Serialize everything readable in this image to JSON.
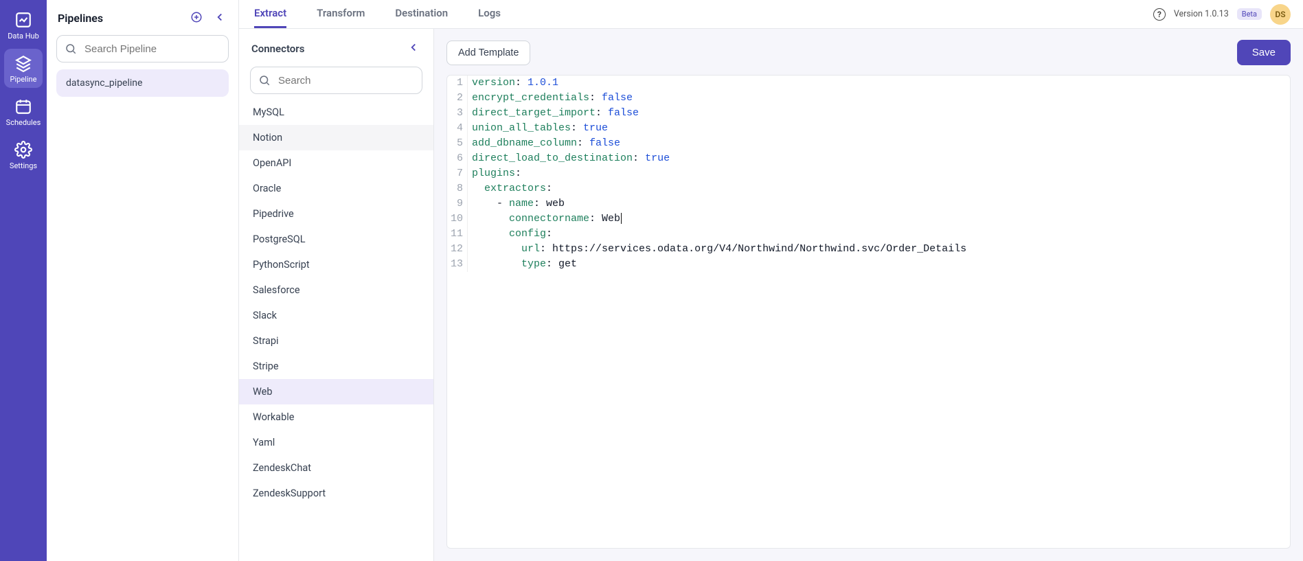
{
  "nav": {
    "items": [
      {
        "label": "Data Hub",
        "active": false
      },
      {
        "label": "Pipeline",
        "active": true
      },
      {
        "label": "Schedules",
        "active": false
      },
      {
        "label": "Settings",
        "active": false
      }
    ]
  },
  "pipelines": {
    "title": "Pipelines",
    "search_placeholder": "Search Pipeline",
    "items": [
      "datasync_pipeline"
    ]
  },
  "tabs": [
    "Extract",
    "Transform",
    "Destination",
    "Logs"
  ],
  "active_tab": "Extract",
  "top_right": {
    "version": "Version 1.0.13",
    "beta": "Beta",
    "avatar": "DS"
  },
  "connectors": {
    "title": "Connectors",
    "search_placeholder": "Search",
    "items": [
      {
        "label": "MySQL"
      },
      {
        "label": "Notion"
      },
      {
        "label": "OpenAPI"
      },
      {
        "label": "Oracle"
      },
      {
        "label": "Pipedrive"
      },
      {
        "label": "PostgreSQL"
      },
      {
        "label": "PythonScript"
      },
      {
        "label": "Salesforce"
      },
      {
        "label": "Slack"
      },
      {
        "label": "Strapi"
      },
      {
        "label": "Stripe"
      },
      {
        "label": "Web"
      },
      {
        "label": "Workable"
      },
      {
        "label": "Yaml"
      },
      {
        "label": "ZendeskChat"
      },
      {
        "label": "ZendeskSupport"
      }
    ],
    "hovered": "Notion",
    "selected": "Web"
  },
  "editor": {
    "add_template": "Add Template",
    "save": "Save",
    "lines": [
      [
        {
          "t": "kw",
          "v": "version"
        },
        {
          "t": "txt",
          "v": ": "
        },
        {
          "t": "val",
          "v": "1.0.1"
        }
      ],
      [
        {
          "t": "kw",
          "v": "encrypt_credentials"
        },
        {
          "t": "txt",
          "v": ": "
        },
        {
          "t": "val",
          "v": "false"
        }
      ],
      [
        {
          "t": "kw",
          "v": "direct_target_import"
        },
        {
          "t": "txt",
          "v": ": "
        },
        {
          "t": "val",
          "v": "false"
        }
      ],
      [
        {
          "t": "kw",
          "v": "union_all_tables"
        },
        {
          "t": "txt",
          "v": ": "
        },
        {
          "t": "val",
          "v": "true"
        }
      ],
      [
        {
          "t": "kw",
          "v": "add_dbname_column"
        },
        {
          "t": "txt",
          "v": ": "
        },
        {
          "t": "val",
          "v": "false"
        }
      ],
      [
        {
          "t": "kw",
          "v": "direct_load_to_destination"
        },
        {
          "t": "txt",
          "v": ": "
        },
        {
          "t": "val",
          "v": "true"
        }
      ],
      [
        {
          "t": "kw",
          "v": "plugins"
        },
        {
          "t": "txt",
          "v": ":"
        }
      ],
      [
        {
          "t": "txt",
          "v": "  "
        },
        {
          "t": "kw",
          "v": "extractors"
        },
        {
          "t": "txt",
          "v": ":"
        }
      ],
      [
        {
          "t": "txt",
          "v": "    - "
        },
        {
          "t": "kw",
          "v": "name"
        },
        {
          "t": "txt",
          "v": ": web"
        }
      ],
      [
        {
          "t": "txt",
          "v": "      "
        },
        {
          "t": "kw",
          "v": "connectorname"
        },
        {
          "t": "txt",
          "v": ": Web"
        }
      ],
      [
        {
          "t": "txt",
          "v": "      "
        },
        {
          "t": "kw",
          "v": "config"
        },
        {
          "t": "txt",
          "v": ":"
        }
      ],
      [
        {
          "t": "txt",
          "v": "        "
        },
        {
          "t": "kw",
          "v": "url"
        },
        {
          "t": "txt",
          "v": ": https://services.odata.org/V4/Northwind/Northwind.svc/Order_Details"
        }
      ],
      [
        {
          "t": "txt",
          "v": "        "
        },
        {
          "t": "kw",
          "v": "type"
        },
        {
          "t": "txt",
          "v": ": get"
        }
      ]
    ],
    "cursor_line": 10
  }
}
